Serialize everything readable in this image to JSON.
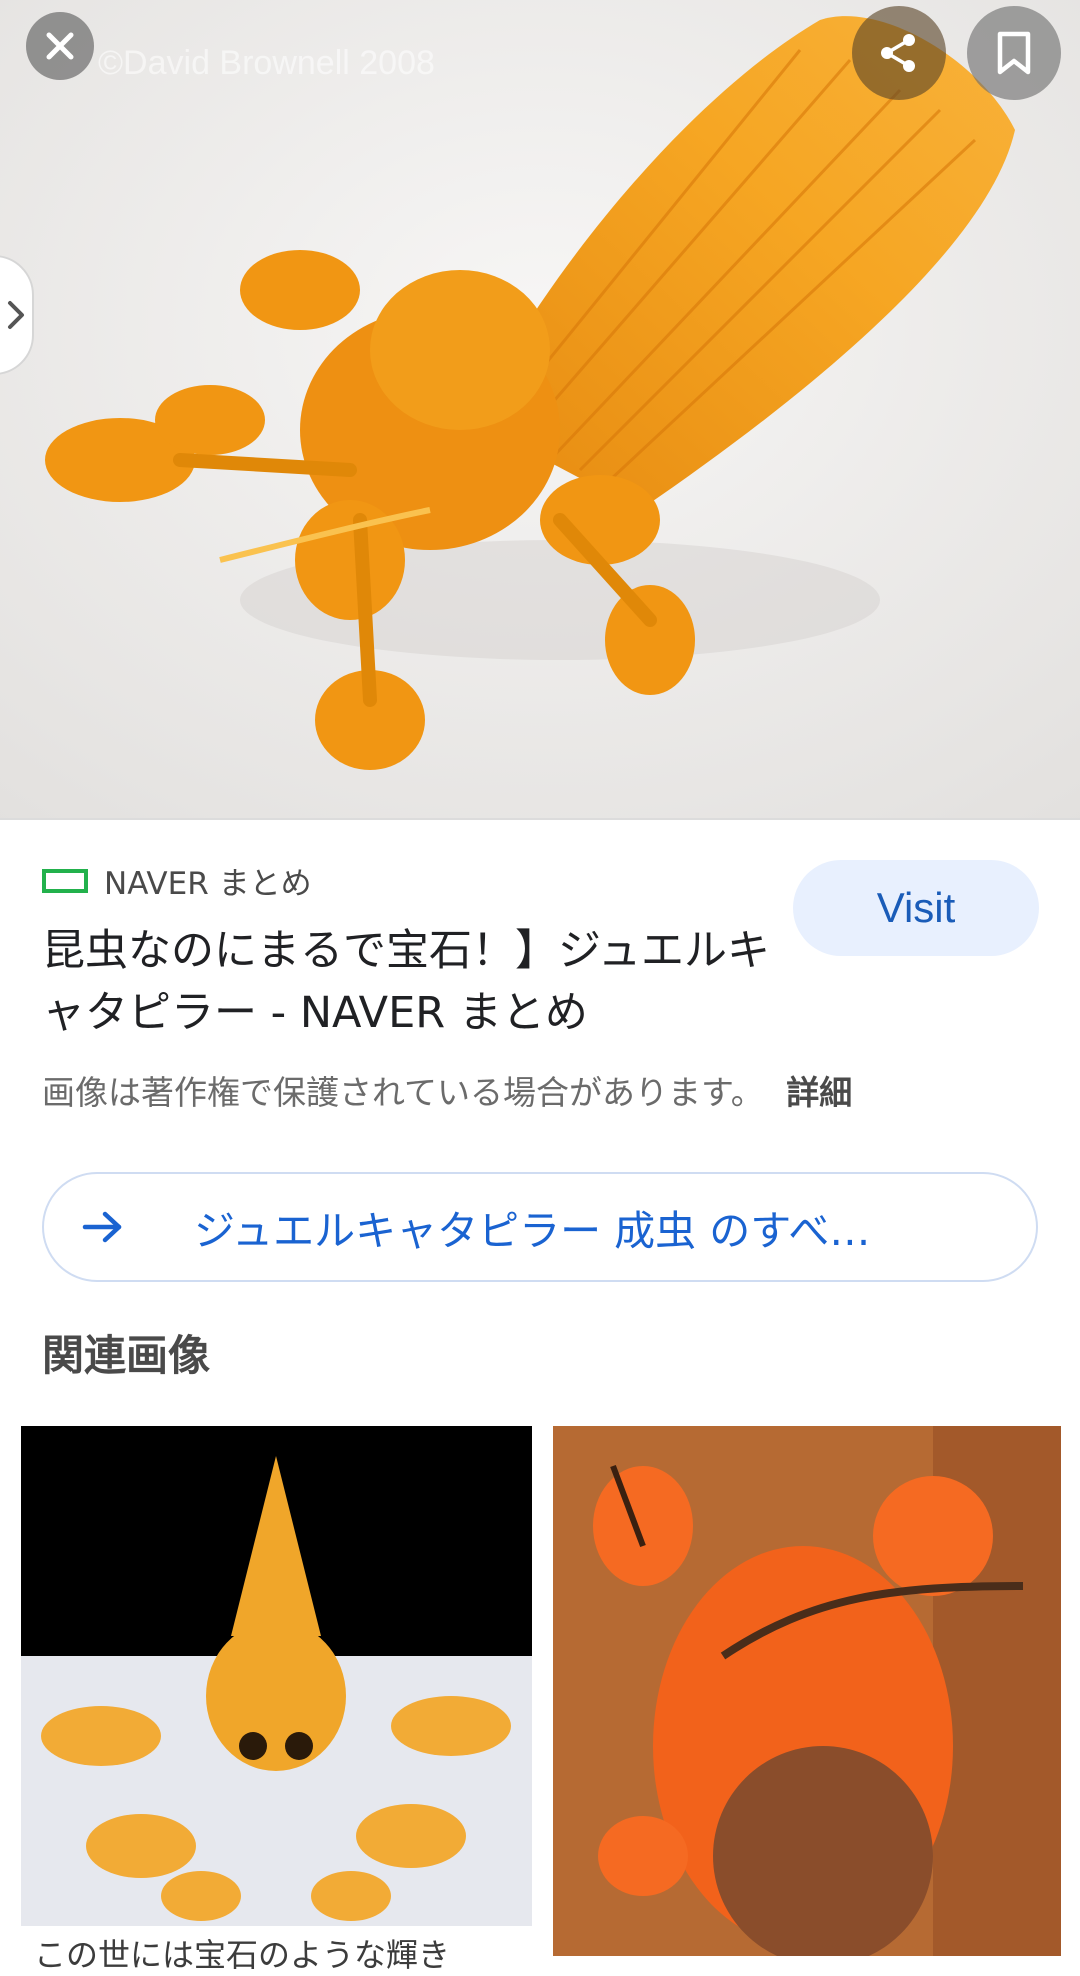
{
  "hero": {
    "watermark": "©David Brownell 2008"
  },
  "toolbar": {
    "close_icon": "close-icon",
    "share_icon": "share-icon",
    "save_icon": "bookmark-icon",
    "side_tab_icon": "chevron-right-icon"
  },
  "result": {
    "source_name": "NAVER まとめ",
    "title": "昆虫なのにまるで宝石！】ジュエルキャタピラー - NAVER まとめ",
    "visit_label": "Visit",
    "copyright_notice": "画像は著作権で保護されている場合があります。",
    "details_link": "詳細",
    "more_label": "ジュエルキャタピラー 成虫 のすべ…"
  },
  "related": {
    "heading": "関連画像",
    "items": [
      {
        "caption": "この世には宝石のような輝き"
      },
      {
        "caption": ""
      }
    ]
  },
  "colors": {
    "accent_blue": "#1a63d1",
    "visit_bg": "#e8f0fe",
    "source_logo_green": "#22b14c"
  }
}
